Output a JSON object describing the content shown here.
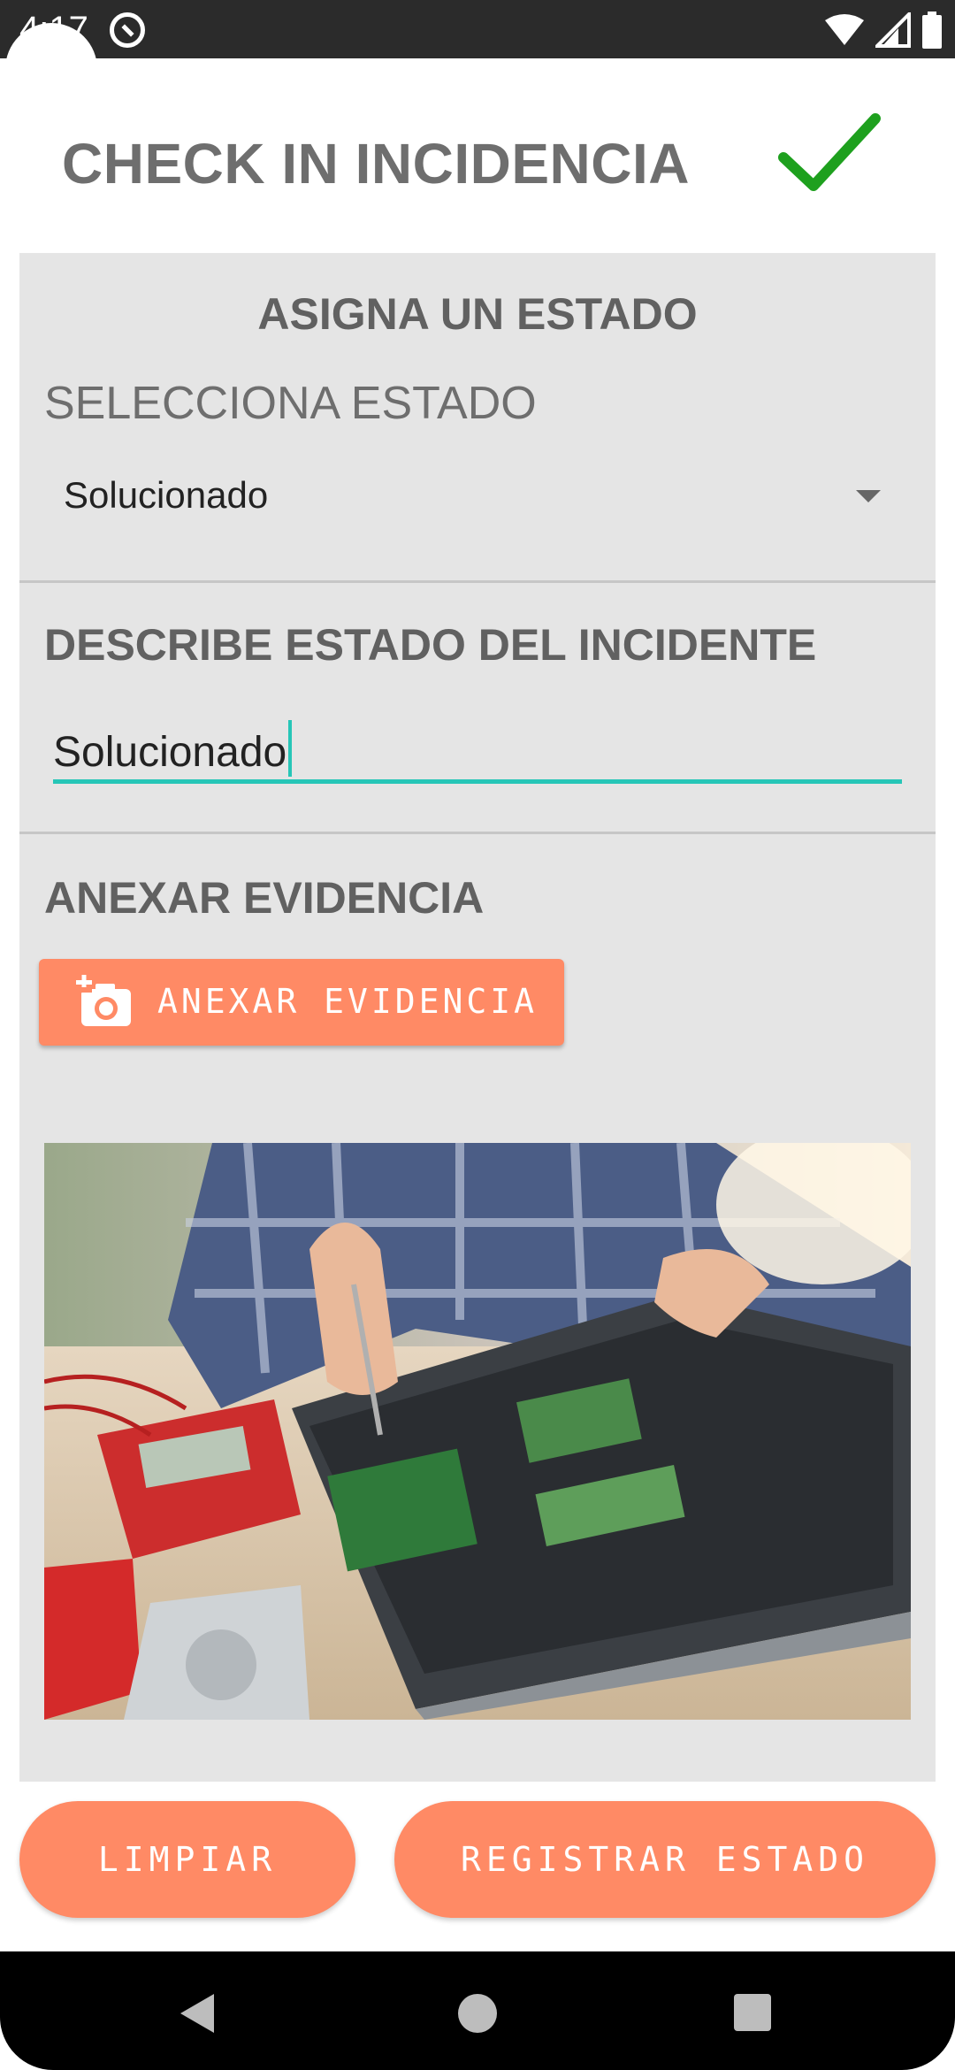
{
  "status_bar": {
    "time": "4:17",
    "icons": [
      "do-not-disturb-icon",
      "wifi-icon",
      "signal-icon",
      "battery-icon"
    ]
  },
  "header": {
    "title": "CHECK IN INCIDENCIA",
    "confirm_icon": "checkmark-icon",
    "confirm_color": "#1ea01e"
  },
  "state_section": {
    "title": "ASIGNA UN ESTADO",
    "label": "SELECCIONA ESTADO",
    "selected_value": "Solucionado"
  },
  "description_section": {
    "title": "DESCRIBE ESTADO DEL INCIDENTE",
    "input_value": "Solucionado"
  },
  "evidence_section": {
    "title": "ANEXAR EVIDENCIA",
    "button_label": "ANEXAR EVIDENCIA",
    "button_icon": "add-photo-icon"
  },
  "actions": {
    "clear_label": "LIMPIAR",
    "register_label": "REGISTRAR ESTADO"
  },
  "colors": {
    "accent": "#ff8a65",
    "input_underline": "#26c6b7",
    "card_background": "#e5e5e5"
  },
  "nav_bar": {
    "icons": [
      "back-icon",
      "home-icon",
      "recents-icon"
    ]
  }
}
